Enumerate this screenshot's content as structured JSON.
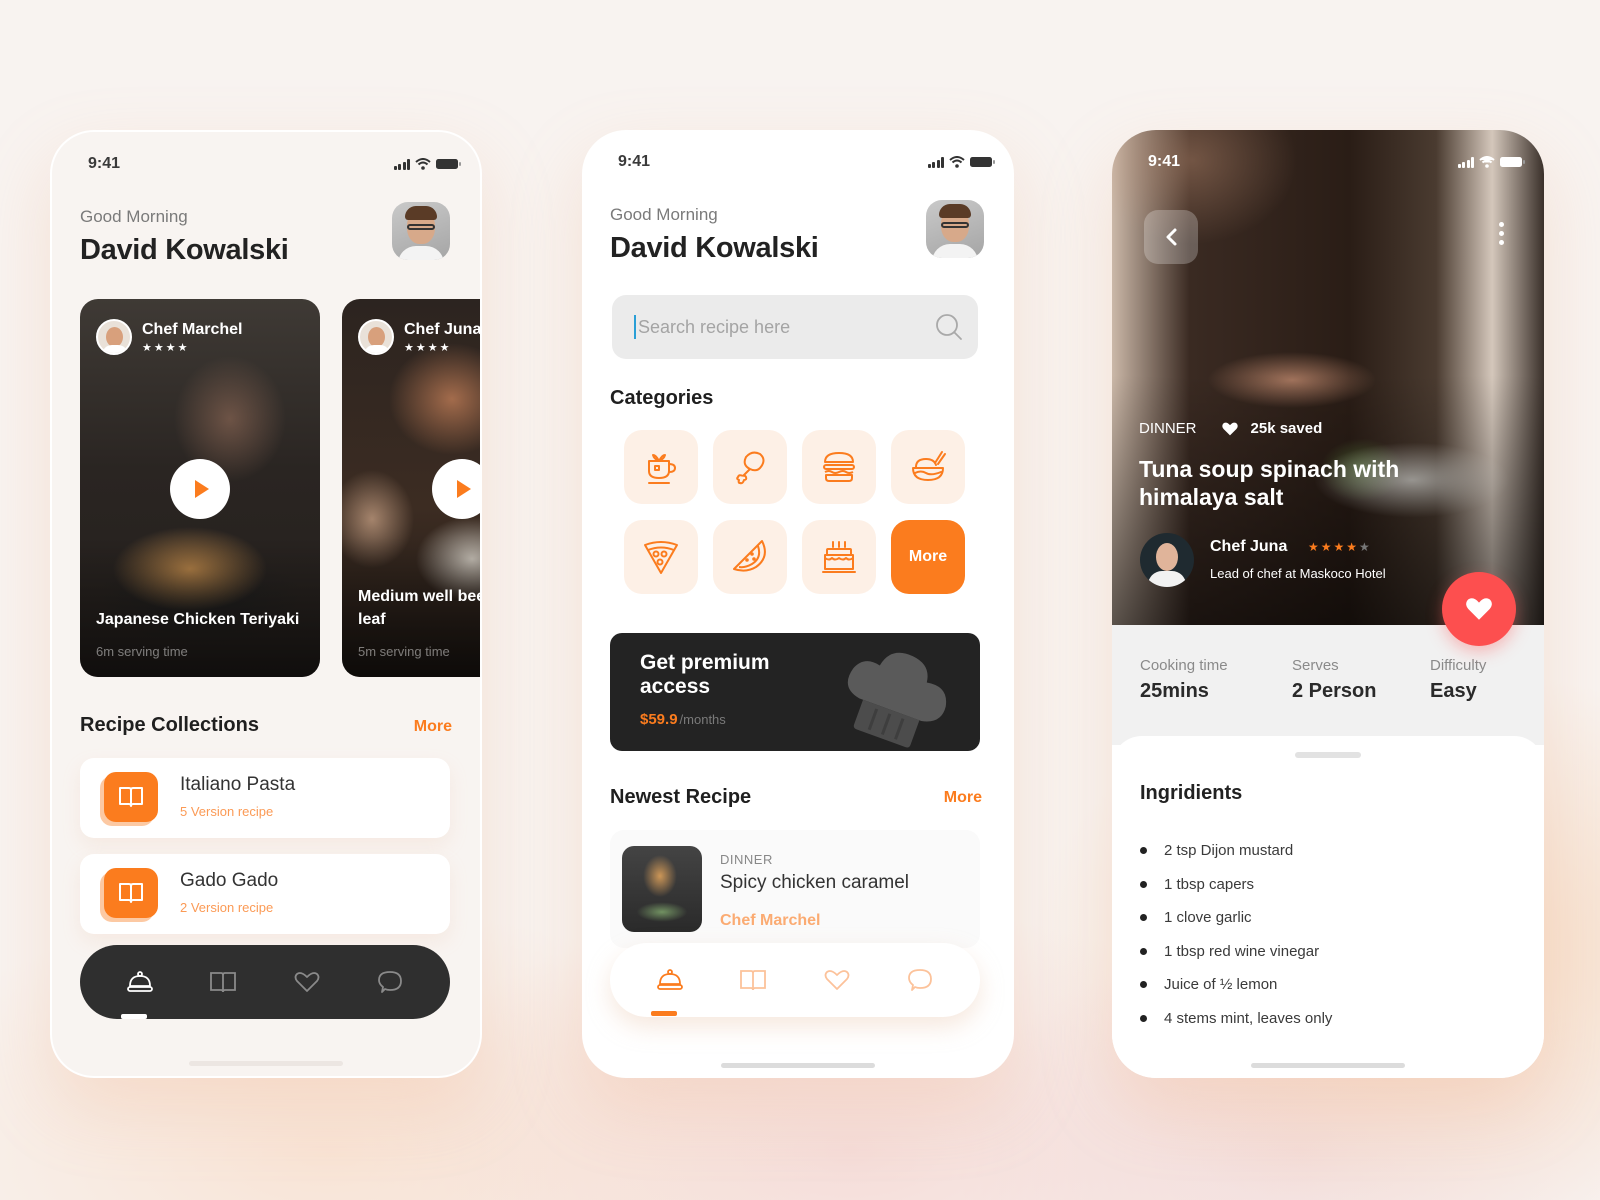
{
  "status_bar": {
    "time": "9:41"
  },
  "home_screen": {
    "greeting": "Good Morning",
    "user_name": "David Kowalski",
    "featured": [
      {
        "chef": "Chef Marchel",
        "rating": 4,
        "title": "Japanese Chicken Teriyaki",
        "serving_time": "6m serving time"
      },
      {
        "chef": "Chef Juna",
        "rating": 4,
        "title": "Medium well beef kemangi leaf",
        "serving_time": "5m serving time"
      }
    ],
    "collections_title": "Recipe Collections",
    "collections_more": "More",
    "collections": [
      {
        "title": "Italiano Pasta",
        "subtitle": "5 Version recipe",
        "icon": "open-book-icon"
      },
      {
        "title": "Gado Gado",
        "subtitle": "2 Version recipe",
        "icon": "open-book-icon"
      }
    ],
    "nav": [
      {
        "name": "home",
        "icon": "cloche-icon",
        "active": true
      },
      {
        "name": "recipes",
        "icon": "open-book-icon",
        "active": false
      },
      {
        "name": "favorites",
        "icon": "heart-icon",
        "active": false
      },
      {
        "name": "chat",
        "icon": "chat-bubble-icon",
        "active": false
      }
    ]
  },
  "search_screen": {
    "greeting": "Good Morning",
    "user_name": "David Kowalski",
    "search": {
      "placeholder": "Search recipe here",
      "value": ""
    },
    "categories_title": "Categories",
    "categories": [
      {
        "name": "drinks",
        "icon": "tea-cup-icon"
      },
      {
        "name": "chicken",
        "icon": "chicken-leg-icon"
      },
      {
        "name": "burger",
        "icon": "burger-icon"
      },
      {
        "name": "rice",
        "icon": "rice-bowl-icon"
      },
      {
        "name": "pizza",
        "icon": "pizza-slice-icon"
      },
      {
        "name": "fruit",
        "icon": "watermelon-icon"
      },
      {
        "name": "cake",
        "icon": "birthday-cake-icon"
      }
    ],
    "categories_more": "More",
    "premium": {
      "title": "Get premium access",
      "price": "$59.9",
      "period": "/months"
    },
    "newest_title": "Newest Recipe",
    "newest_more": "More",
    "newest": {
      "category": "DINNER",
      "title": "Spicy chicken caramel",
      "chef": "Chef Marchel"
    },
    "nav": [
      {
        "name": "home",
        "icon": "cloche-icon",
        "active": true
      },
      {
        "name": "recipes",
        "icon": "open-book-icon",
        "active": false
      },
      {
        "name": "favorites",
        "icon": "heart-icon",
        "active": false
      },
      {
        "name": "chat",
        "icon": "chat-bubble-icon",
        "active": false
      }
    ]
  },
  "detail_screen": {
    "category": "DINNER",
    "saved": "25k saved",
    "title": "Tuna soup spinach with himalaya salt",
    "chef_name": "Chef Juna",
    "chef_rating": 4,
    "chef_rating_max": 5,
    "chef_role": "Lead of chef at Maskoco Hotel",
    "stats": [
      {
        "label": "Cooking time",
        "value": "25mins"
      },
      {
        "label": "Serves",
        "value": "2 Person"
      },
      {
        "label": "Difficulty",
        "value": "Easy"
      }
    ],
    "ingredients_title": "Ingridients",
    "ingredients": [
      "2 tsp Dijon mustard",
      "1 tbsp capers",
      "1 clove garlic",
      "1 tbsp red wine vinegar",
      "Juice of ½ lemon",
      "4 stems mint, leaves only"
    ]
  },
  "colors": {
    "accent": "#fb7c1e",
    "accent_light": "#fdf0e6",
    "favorite": "#fd4f4f",
    "dark": "#2f2f2f"
  }
}
